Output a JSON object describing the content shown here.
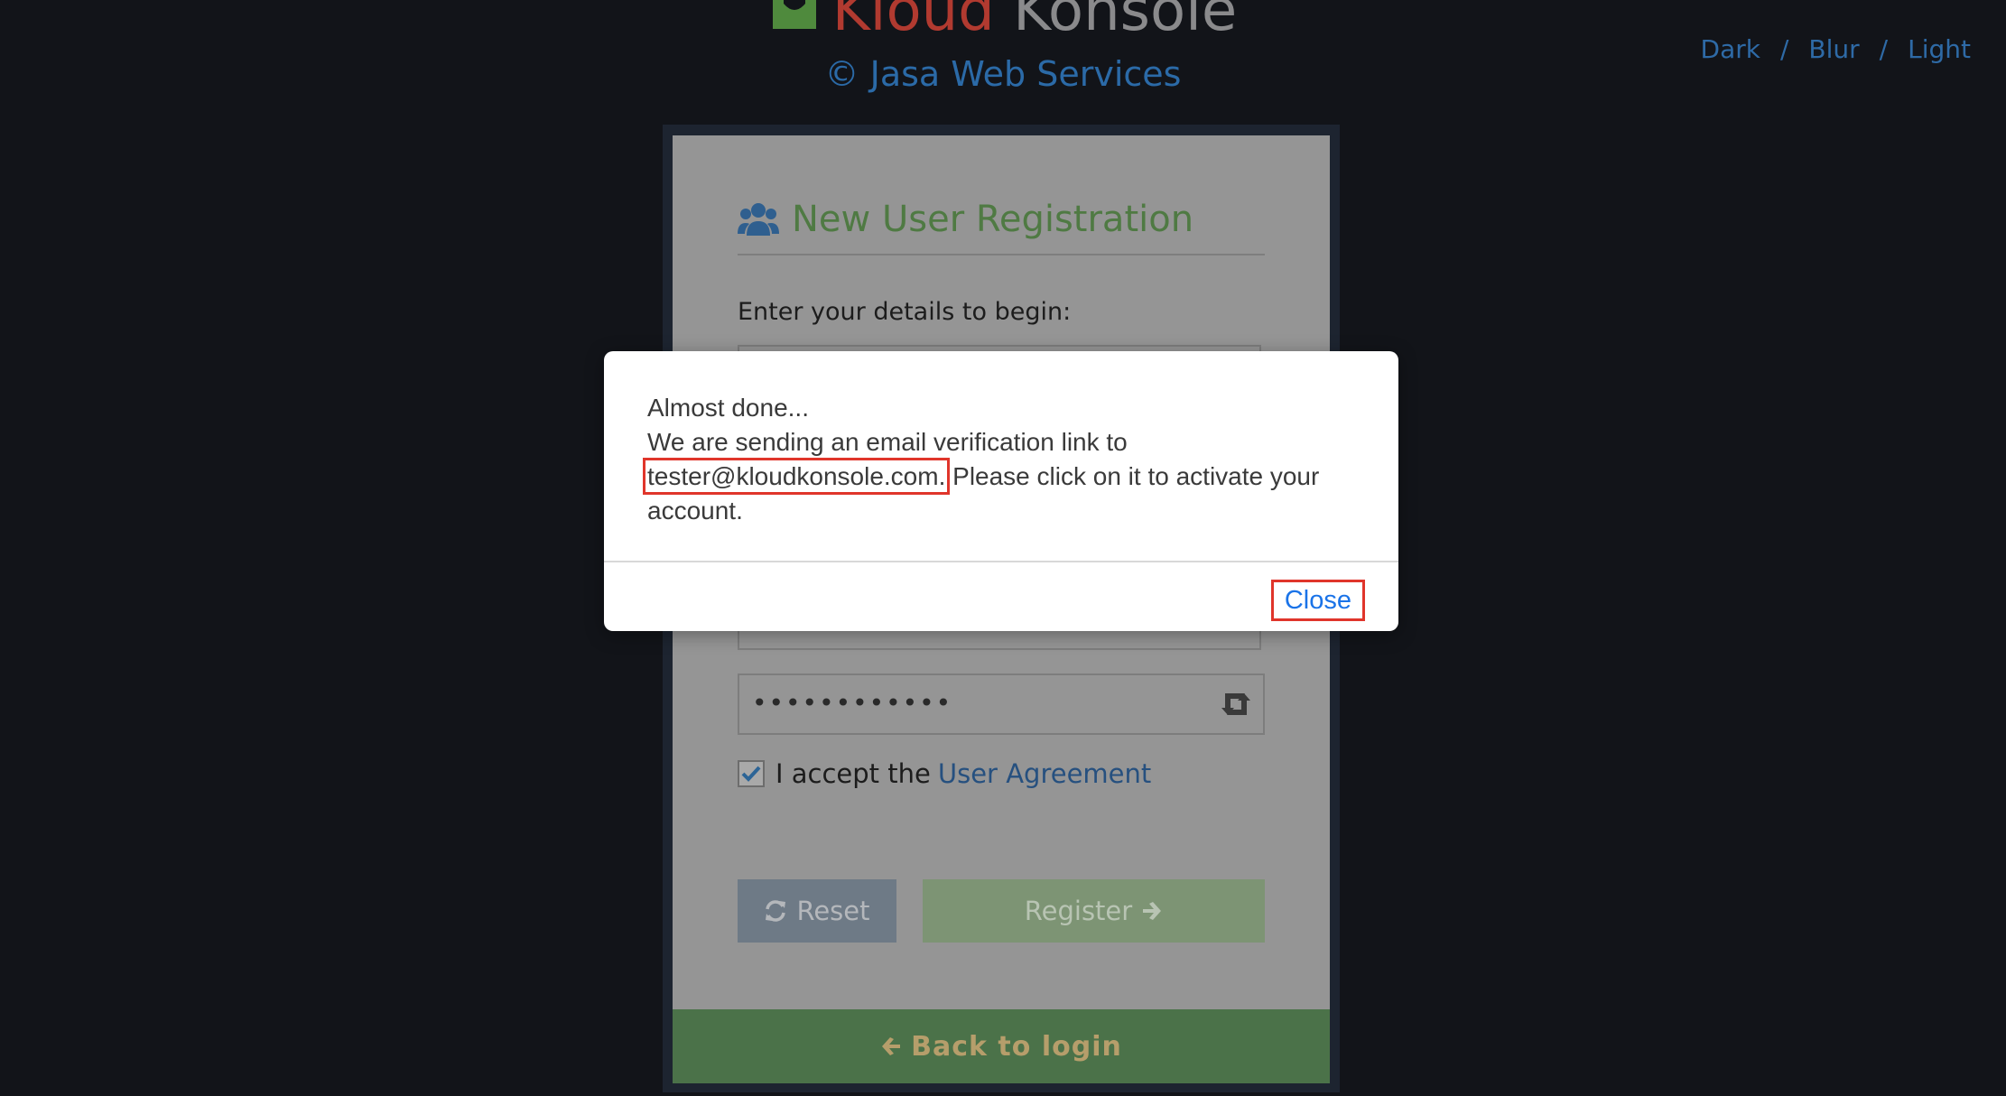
{
  "header": {
    "brand_word_1": "Kloud",
    "brand_word_2": "Konsole",
    "copyright": "© Jasa Web Services",
    "theme_options": [
      "Dark",
      "Blur",
      "Light"
    ],
    "theme_separator": "/"
  },
  "registration": {
    "title": "New User Registration",
    "instructions": "Enter your details to begin:",
    "password_masked": "••••••••••••",
    "accept_prefix": "I accept the",
    "agreement_link": "User Agreement",
    "terms_accepted": true,
    "reset_label": "Reset",
    "register_label": "Register",
    "back_to_login": "Back to login"
  },
  "modal": {
    "line1": "Almost done...",
    "line2": "We are sending an email verification link to",
    "email": "tester@kloudkonsole.com.",
    "line3_rest": " Please click on it to activate your",
    "line4": "account.",
    "close_label": "Close"
  },
  "colors": {
    "background": "#121419",
    "brand_red": "#b13a30",
    "link_blue": "#2e6aa6",
    "highlight_red": "#e0352b",
    "modal_link": "#1a73e8"
  },
  "icons": {
    "brand": "cloud-box-icon",
    "title": "users-icon",
    "password_toggle": "retweet-icon",
    "reset": "refresh-icon",
    "register": "arrow-right-icon",
    "back": "arrow-left-icon",
    "checkbox": "check-icon"
  }
}
